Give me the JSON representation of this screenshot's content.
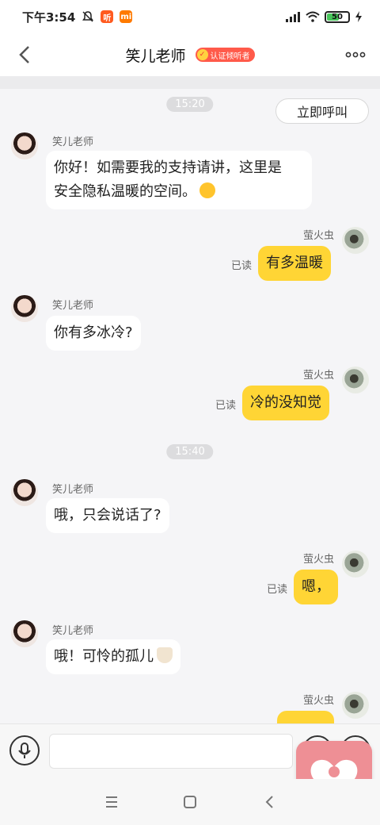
{
  "status_bar": {
    "time": "下午3:54",
    "badge1": "听",
    "badge2": "mi",
    "battery": "50"
  },
  "header": {
    "title": "笑儿老师",
    "badge": "认证倾听者"
  },
  "chat": {
    "call_button": "立即呼叫",
    "timestamps": [
      "15:20",
      "15:40"
    ],
    "messages": [
      {
        "sender": "笑儿老师",
        "text": "你好！如需要我的支持请讲，这里是",
        "text2": "安全隐私温暖的空间。"
      },
      {
        "sender": "萤火虫",
        "text": "有多温暖",
        "status": "已读"
      },
      {
        "sender": "笑儿老师",
        "text": "你有多冰冷?"
      },
      {
        "sender": "萤火虫",
        "text": "冷的没知觉",
        "status": "已读"
      },
      {
        "sender": "笑儿老师",
        "text": "哦，只会说话了?"
      },
      {
        "sender": "萤火虫",
        "text": "嗯，",
        "status": "已读"
      },
      {
        "sender": "笑儿老师",
        "text": "哦！可怜的孤儿"
      },
      {
        "sender": "萤火虫",
        "text": ""
      }
    ]
  },
  "input": {
    "placeholder": ""
  },
  "colors": {
    "accent": "#ffd535",
    "badge": "#ff5a4a",
    "heart": "#ee8f95"
  }
}
